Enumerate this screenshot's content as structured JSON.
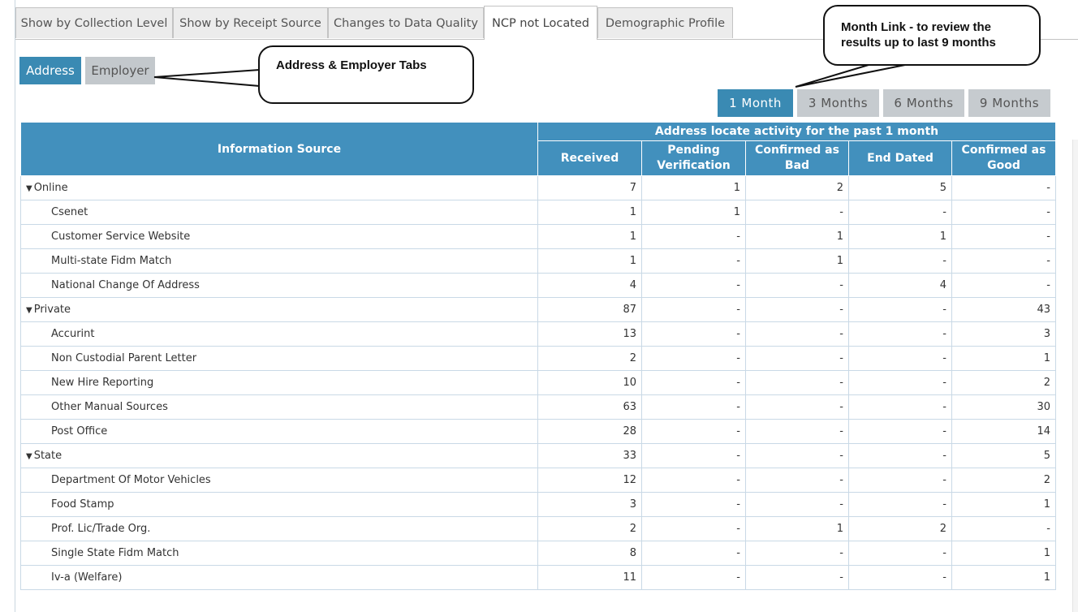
{
  "tabs": [
    {
      "label": "Show by Collection Level",
      "active": false
    },
    {
      "label": "Show by Receipt Source",
      "active": false
    },
    {
      "label": "Changes to Data Quality",
      "active": false
    },
    {
      "label": "NCP not Located",
      "active": true
    },
    {
      "label": "Demographic Profile",
      "active": false
    }
  ],
  "subtabs": {
    "address": "Address",
    "employer": "Employer",
    "active": "Address"
  },
  "months": {
    "m1": "1 Month",
    "m3": "3 Months",
    "m6": "6 Months",
    "m9": "9 Months",
    "active": "1 Month"
  },
  "callouts": {
    "tabs_note": "Address & Employer Tabs",
    "month_note_line1": "Month Link - to review the",
    "month_note_line2": "results up to last 9 months"
  },
  "table": {
    "col_info_source": "Information Source",
    "group_header": "Address locate activity for the past 1 month",
    "col_received": "Received",
    "col_pending_1": "Pending",
    "col_pending_2": "Verification",
    "col_bad": "Confirmed as Bad",
    "col_end_dated": "End Dated",
    "col_good_1": "Confirmed as",
    "col_good_2": "Good",
    "rows": [
      {
        "type": "group",
        "label": "Online",
        "received": "7",
        "pending": "1",
        "bad": "2",
        "end_dated": "5",
        "good": "-"
      },
      {
        "type": "child",
        "label": "Csenet",
        "received": "1",
        "pending": "1",
        "bad": "-",
        "end_dated": "-",
        "good": "-"
      },
      {
        "type": "child",
        "label": "Customer Service Website",
        "received": "1",
        "pending": "-",
        "bad": "1",
        "end_dated": "1",
        "good": "-"
      },
      {
        "type": "child",
        "label": "Multi-state Fidm Match",
        "received": "1",
        "pending": "-",
        "bad": "1",
        "end_dated": "-",
        "good": "-"
      },
      {
        "type": "child",
        "label": "National Change Of Address",
        "received": "4",
        "pending": "-",
        "bad": "-",
        "end_dated": "4",
        "good": "-"
      },
      {
        "type": "group",
        "label": "Private",
        "received": "87",
        "pending": "-",
        "bad": "-",
        "end_dated": "-",
        "good": "43"
      },
      {
        "type": "child",
        "label": "Accurint",
        "received": "13",
        "pending": "-",
        "bad": "-",
        "end_dated": "-",
        "good": "3"
      },
      {
        "type": "child",
        "label": "Non Custodial Parent Letter",
        "received": "2",
        "pending": "-",
        "bad": "-",
        "end_dated": "-",
        "good": "1"
      },
      {
        "type": "child",
        "label": "New Hire Reporting",
        "received": "10",
        "pending": "-",
        "bad": "-",
        "end_dated": "-",
        "good": "2"
      },
      {
        "type": "child",
        "label": "Other Manual Sources",
        "received": "63",
        "pending": "-",
        "bad": "-",
        "end_dated": "-",
        "good": "30"
      },
      {
        "type": "child",
        "label": "Post Office",
        "received": "28",
        "pending": "-",
        "bad": "-",
        "end_dated": "-",
        "good": "14"
      },
      {
        "type": "group",
        "label": "State",
        "received": "33",
        "pending": "-",
        "bad": "-",
        "end_dated": "-",
        "good": "5"
      },
      {
        "type": "child",
        "label": "Department Of Motor Vehicles",
        "received": "12",
        "pending": "-",
        "bad": "-",
        "end_dated": "-",
        "good": "2"
      },
      {
        "type": "child",
        "label": "Food Stamp",
        "received": "3",
        "pending": "-",
        "bad": "-",
        "end_dated": "-",
        "good": "1"
      },
      {
        "type": "child",
        "label": "Prof. Lic/Trade Org.",
        "received": "2",
        "pending": "-",
        "bad": "1",
        "end_dated": "2",
        "good": "-"
      },
      {
        "type": "child",
        "label": "Single State Fidm Match",
        "received": "8",
        "pending": "-",
        "bad": "-",
        "end_dated": "-",
        "good": "1"
      },
      {
        "type": "child",
        "label": "Iv-a (Welfare)",
        "received": "11",
        "pending": "-",
        "bad": "-",
        "end_dated": "-",
        "good": "1"
      }
    ]
  },
  "icons": {
    "expand": "caret-down-icon"
  }
}
